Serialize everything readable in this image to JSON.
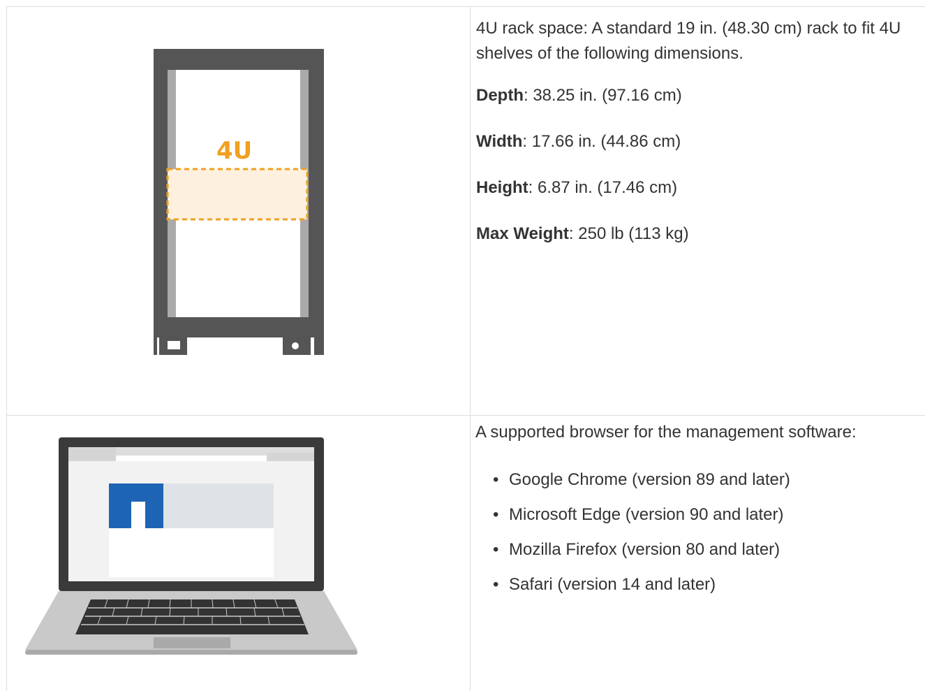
{
  "rack_section": {
    "figure_label": "4U",
    "intro": "4U rack space: A standard 19 in. (48.30 cm) rack to fit 4U shelves of the following dimensions.",
    "specs": [
      {
        "label": "Depth",
        "value": ": 38.25 in. (97.16 cm)"
      },
      {
        "label": "Width",
        "value": ": 17.66 in. (44.86 cm)"
      },
      {
        "label": "Height",
        "value": ": 6.87 in. (17.46 cm)"
      },
      {
        "label": "Max Weight",
        "value": ": 250 lb (113 kg)"
      }
    ]
  },
  "browser_section": {
    "intro": "A supported browser for the management software:",
    "browsers": [
      "Google Chrome (version 89 and later)",
      "Microsoft Edge (version 90 and later)",
      "Mozilla Firefox (version 80 and later)",
      "Safari (version 14 and later)"
    ],
    "bullet": "•"
  },
  "colors": {
    "border": "#dddddd",
    "text": "#333333",
    "rack_frame": "#555555",
    "rack_highlight": "#f0a020",
    "rack_fill": "#fdf0de",
    "brand_blue": "#1e64b4"
  }
}
